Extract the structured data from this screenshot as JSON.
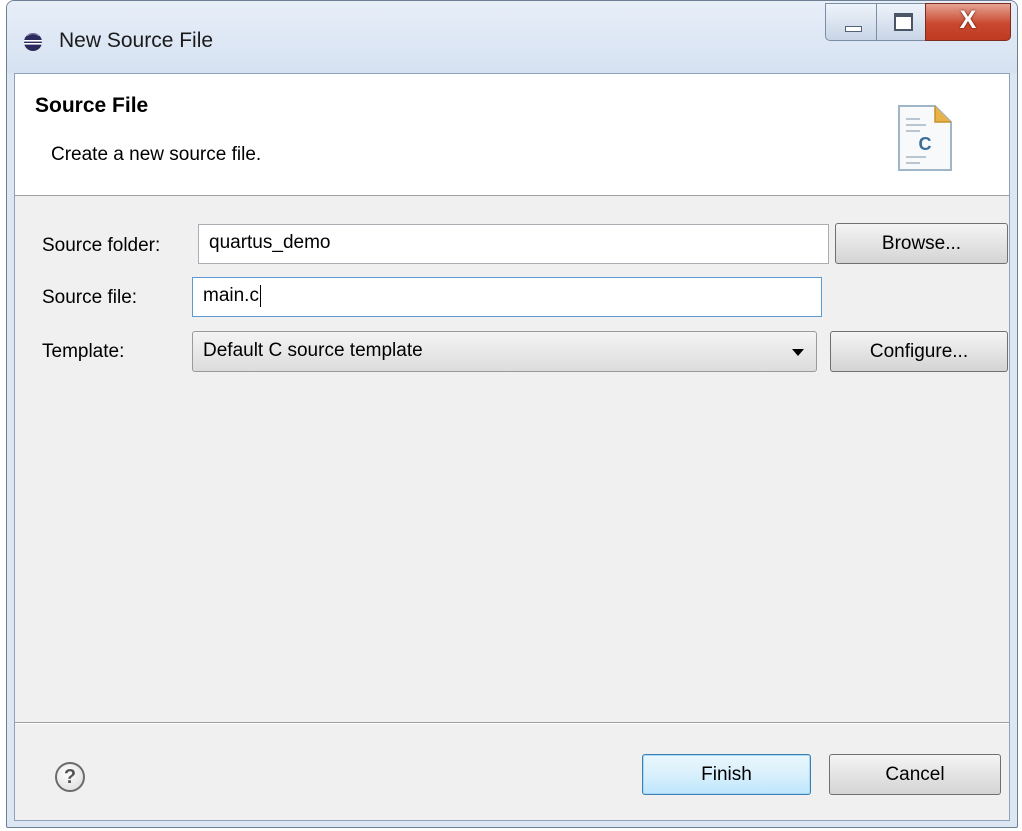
{
  "window": {
    "title": "New Source File",
    "controls": {
      "minimize": "minimize",
      "maximize": "maximize",
      "close": "X"
    }
  },
  "banner": {
    "title": "Source File",
    "description": "Create a new source file.",
    "icon": "c-source-file-icon",
    "icon_letter": "C"
  },
  "form": {
    "source_folder": {
      "label": "Source folder:",
      "value": "quartus_demo"
    },
    "source_file": {
      "label": "Source file:",
      "value": "main.c"
    },
    "template": {
      "label": "Template:",
      "value": "Default C source template"
    }
  },
  "buttons": {
    "browse": "Browse...",
    "configure": "Configure...",
    "finish": "Finish",
    "cancel": "Cancel",
    "help": "?"
  },
  "colors": {
    "title_bar": "#d6e2f1",
    "close_button": "#c9482f",
    "default_button": "#bee6fd",
    "dialog_background": "#f0f0f0"
  }
}
